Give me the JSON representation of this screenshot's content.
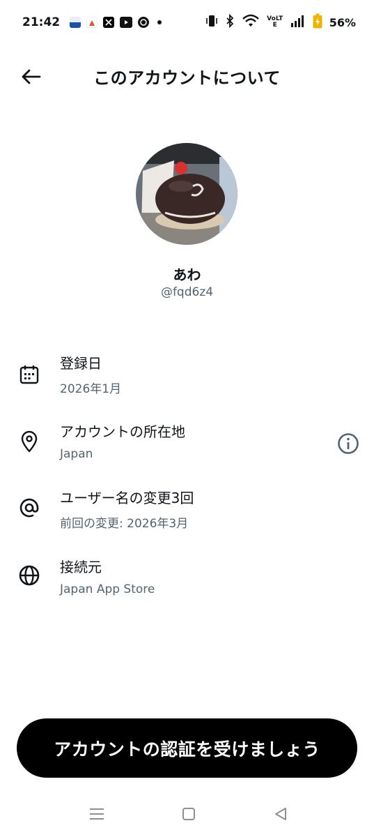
{
  "status_bar": {
    "time": "21:42",
    "battery": "56%",
    "network": "VoLTE",
    "icons": [
      "vibrate-icon",
      "bluetooth-icon",
      "wifi-icon",
      "signal-icon",
      "battery-charging-icon"
    ],
    "app_icons": [
      "news-app-icon",
      "food-app-icon",
      "x-app-icon",
      "youtube-app-icon",
      "browser-app-icon"
    ]
  },
  "header": {
    "title": "このアカウントについて",
    "back_icon": "arrow-left-icon"
  },
  "profile": {
    "display_name": "あわ",
    "handle": "@fqd6z4"
  },
  "info": [
    {
      "label": "登録日",
      "value": "2026年1月",
      "icon": "calendar-icon"
    },
    {
      "label": "アカウントの所在地",
      "value": "Japan",
      "icon": "location-pin-icon",
      "trailing_icon": "info-icon"
    },
    {
      "label": "ユーザー名の変更3回",
      "value": "前回の変更: 2026年3月",
      "icon": "at-icon"
    },
    {
      "label": "接続元",
      "value": "Japan App Store",
      "icon": "globe-icon"
    }
  ],
  "verify_button": {
    "label": "アカウントの認証を受けましょう"
  },
  "nav": [
    "menu-icon",
    "home-square-icon",
    "back-triangle-icon"
  ],
  "colors": {
    "text": "#0f1419",
    "secondary": "#536471",
    "button_bg": "#000000"
  }
}
